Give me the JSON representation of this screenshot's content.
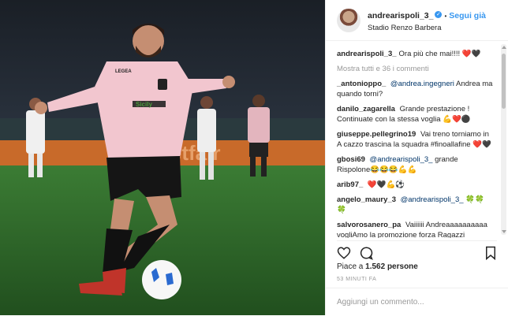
{
  "header": {
    "username": "andrearispoli_3_",
    "follow_label": "Segui già",
    "location": "Stadio Renzo Barbera",
    "dot": "•",
    "verified_glyph": "✓"
  },
  "caption": {
    "user": "andrearispoli_3_",
    "text": "Ora più che mai!!!! ❤️🖤"
  },
  "show_all": "Mostra tutti e 36 i commenti",
  "comments": [
    {
      "user": "_antonioppo_",
      "mention": "@andrea.ingegneri",
      "text": "Andrea ma quando torni?"
    },
    {
      "user": "danilo_zagarella",
      "mention": "",
      "text": "Grande prestazione ! Continuate con la stessa voglia 💪❤️⚫"
    },
    {
      "user": "giuseppe.pellegrino19",
      "mention": "",
      "text": "Vai treno torniamo in A cazzo trascina la squadra #finoallafine ❤️🖤"
    },
    {
      "user": "gbosi69",
      "mention": "@andrearispoli_3_",
      "text": "grande Rispolone😂😂😂💪💪"
    },
    {
      "user": "arib97_",
      "mention": "",
      "text": "❤️🖤💪⚽"
    },
    {
      "user": "angelo_maury_3",
      "mention": "@andrearispoli_3_",
      "text": "🍀🍀🍀"
    },
    {
      "user": "salvorosanero_pa",
      "mention": "",
      "text": "Vaiiiiii Andreaaaaaaaaaa vogliAmo la promozione forza Ragazzi andiAmo!! ❤️🖤!!!"
    }
  ],
  "likes": {
    "prefix": "Piace a",
    "count": "1.562",
    "suffix": "persone"
  },
  "time": "53 MINUTI FA",
  "add_comment_placeholder": "Aggiungi un commento...",
  "photo": {
    "ad_board_text": "betfair",
    "sponsor_text": "Sicily",
    "kit_brand": "LEGEA"
  },
  "colors": {
    "link": "#3897f0",
    "mention": "#003569",
    "kit_pink": "#f2c6cf",
    "pitch": "#2e6b2a"
  }
}
